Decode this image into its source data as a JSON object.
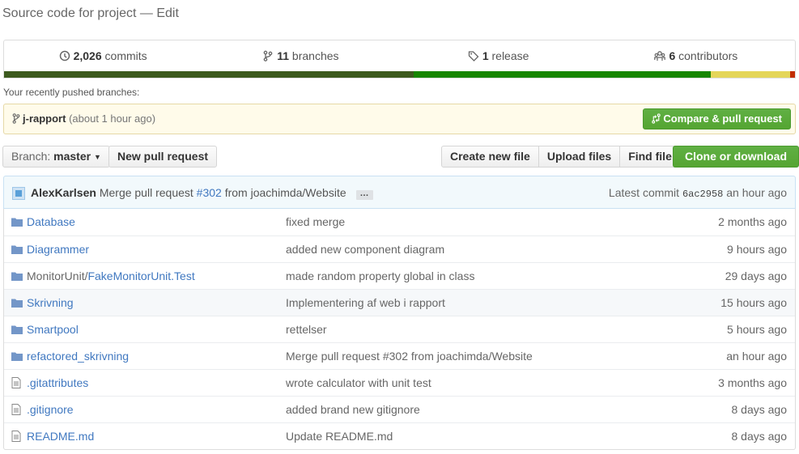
{
  "repo": {
    "description": "Source code for project",
    "separator": "—",
    "edit_link": "Edit"
  },
  "summary": {
    "commits": {
      "count": "2,026",
      "label": "commits",
      "icon": "history-icon"
    },
    "branches": {
      "count": "11",
      "label": "branches",
      "icon": "branch-icon"
    },
    "releases": {
      "count": "1",
      "label": "release",
      "icon": "tag-icon"
    },
    "contributors": {
      "count": "6",
      "label": "contributors",
      "icon": "organization-icon"
    }
  },
  "language_bar": [
    {
      "color": "#3d5a1e",
      "share": 0.518
    },
    {
      "color": "#178600",
      "share": 0.376
    },
    {
      "color": "#e4d65a",
      "share": 0.1
    },
    {
      "color": "#c22d00",
      "share": 0.006
    }
  ],
  "recent_branches": {
    "label": "Your recently pushed branches:",
    "branch": "j-rapport",
    "time": "(about 1 hour ago)",
    "compare_button": "Compare & pull request"
  },
  "toolbar": {
    "branch_label": "Branch:",
    "branch_value": "master",
    "new_pull_request": "New pull request",
    "create_new_file": "Create new file",
    "upload_files": "Upload files",
    "find_file": "Find file",
    "clone_or_download": "Clone or download"
  },
  "latest_commit": {
    "author": "AlexKarlsen",
    "message_prefix": "Merge pull request",
    "pr_link": "#302",
    "message_suffix": "from joachimda/Website",
    "ellipsis": "…",
    "latest_label": "Latest commit",
    "sha": "6ac2958",
    "time": "an hour ago"
  },
  "files": [
    {
      "type": "dir",
      "prefix": "",
      "name": "Database",
      "message": "fixed merge",
      "age": "2 months ago"
    },
    {
      "type": "dir",
      "prefix": "",
      "name": "Diagrammer",
      "message": "added new component diagram",
      "age": "9 hours ago"
    },
    {
      "type": "dir",
      "prefix": "MonitorUnit/",
      "name": "FakeMonitorUnit.Test",
      "message": "made random property global in class",
      "age": "29 days ago"
    },
    {
      "type": "dir",
      "prefix": "",
      "name": "Skrivning",
      "message": "Implementering af web i rapport",
      "age": "15 hours ago"
    },
    {
      "type": "dir",
      "prefix": "",
      "name": "Smartpool",
      "message": "rettelser",
      "age": "5 hours ago"
    },
    {
      "type": "dir",
      "prefix": "",
      "name": "refactored_skrivning",
      "message": "Merge pull request #302 from joachimda/Website",
      "age": "an hour ago"
    },
    {
      "type": "file",
      "prefix": "",
      "name": ".gitattributes",
      "message": "wrote calculator with unit test",
      "age": "3 months ago"
    },
    {
      "type": "file",
      "prefix": "",
      "name": ".gitignore",
      "message": "added brand new gitignore",
      "age": "8 days ago"
    },
    {
      "type": "file",
      "prefix": "",
      "name": "README.md",
      "message": "Update README.md",
      "age": "8 days ago"
    }
  ],
  "colors": {
    "link": "#4078c0",
    "primary_button": "#55a532",
    "folder_icon": "#7396c8",
    "file_icon": "#888888"
  }
}
